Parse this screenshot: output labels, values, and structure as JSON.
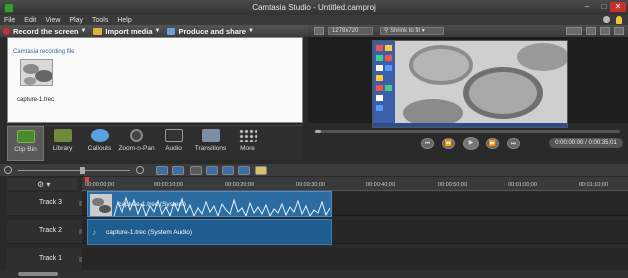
{
  "window": {
    "title": "Camtasia Studio - Untitled.camproj"
  },
  "menu": [
    "File",
    "Edit",
    "View",
    "Play",
    "Tools",
    "Help"
  ],
  "toolbar": {
    "record_label": "Record the screen",
    "import_label": "Import media",
    "produce_label": "Produce and share"
  },
  "clip_bin": {
    "section_label": "Camtasia recording file",
    "clip_name": "capture-1.trec"
  },
  "tabs": [
    {
      "label": "Clip Bin",
      "active": true
    },
    {
      "label": "Library"
    },
    {
      "label": "Callouts"
    },
    {
      "label": "Zoom-n-Pan"
    },
    {
      "label": "Audio"
    },
    {
      "label": "Transitions"
    },
    {
      "label": "More"
    }
  ],
  "preview": {
    "resolution": "1278x720",
    "fit_label": "Shrink to fit",
    "timecode": "0:00:00:00 / 0:00:35;01"
  },
  "ruler": {
    "ticks": [
      "00:00:00;00",
      "00:00:10;00",
      "00:00:20;00",
      "00:00:30;00",
      "00:00:40;00",
      "00:00:50;00",
      "00:01:00;00",
      "00:01:10;00"
    ]
  },
  "tracks": [
    {
      "name": "Track 3",
      "clip": "capture-1.trec (System)"
    },
    {
      "name": "Track 2",
      "clip": "capture-1.trec (System Audio)"
    },
    {
      "name": "Track 1",
      "clip": ""
    }
  ],
  "colors": {
    "accent": "#2b6da3",
    "record": "#d12c2c",
    "close": "#c8302c"
  }
}
